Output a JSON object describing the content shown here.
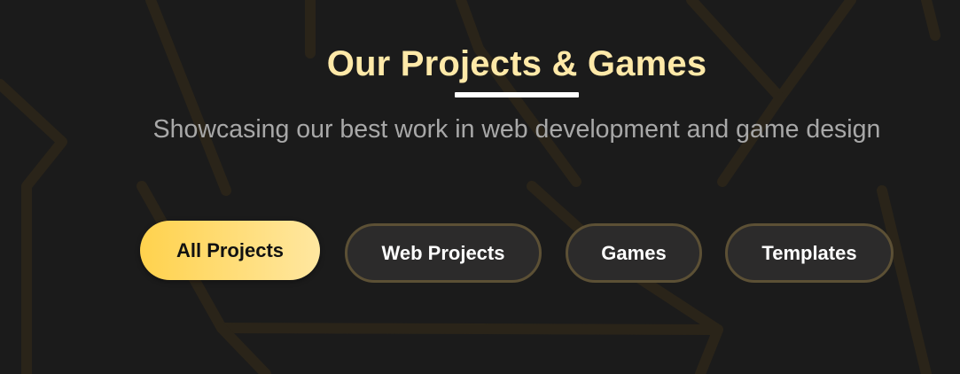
{
  "section": {
    "title": "Our Projects & Games",
    "subtitle": "Showcasing our best work in web development and game design"
  },
  "filters": [
    {
      "label": "All Projects",
      "active": true
    },
    {
      "label": "Web Projects",
      "active": false
    },
    {
      "label": "Games",
      "active": false
    },
    {
      "label": "Templates",
      "active": false
    }
  ],
  "colors": {
    "background": "#1b1b1b",
    "title": "#ffe9a8",
    "subtitle": "#a8a8a8",
    "accent_gradient_start": "#ffd24d",
    "accent_gradient_end": "#ffe7a0",
    "button_border": "#5c5035",
    "button_bg": "#2c2b2b",
    "decor_lines": "#2a2419"
  }
}
